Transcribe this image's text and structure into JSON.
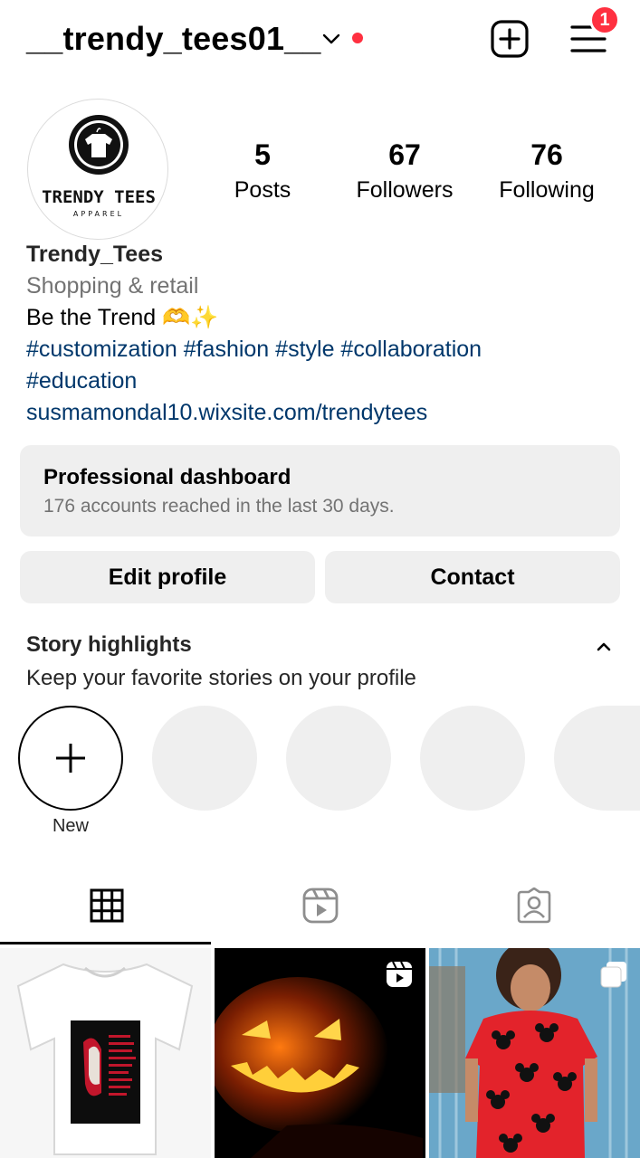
{
  "header": {
    "username": "__trendy_tees01__",
    "notification_count": "1"
  },
  "profile": {
    "avatar_logo_text": "TRENDY TEES",
    "avatar_logo_subtext": "APPAREL",
    "stats": [
      {
        "value": "5",
        "label": "Posts"
      },
      {
        "value": "67",
        "label": "Followers"
      },
      {
        "value": "76",
        "label": "Following"
      }
    ],
    "name": "Trendy_Tees",
    "category": "Shopping & retail",
    "bio_line": "Be the Trend 🫶✨",
    "hashtags_line1": "#customization #fashion #style #collaboration",
    "hashtags_line2": "#education",
    "link": "susmamondal10.wixsite.com/trendytees"
  },
  "dashboard": {
    "title": "Professional dashboard",
    "subtitle": "176 accounts reached in the last 30 days."
  },
  "actions": {
    "edit_profile": "Edit profile",
    "contact": "Contact"
  },
  "highlights": {
    "title": "Story highlights",
    "subtitle": "Keep your favorite stories on your profile",
    "new_label": "New"
  },
  "tabs": [
    "grid-icon",
    "reels-icon",
    "tagged-icon"
  ],
  "colors": {
    "accent_red": "#ff3040",
    "link_blue": "#00376b",
    "secondary_text": "#737373",
    "surface_gray": "#efefef"
  }
}
